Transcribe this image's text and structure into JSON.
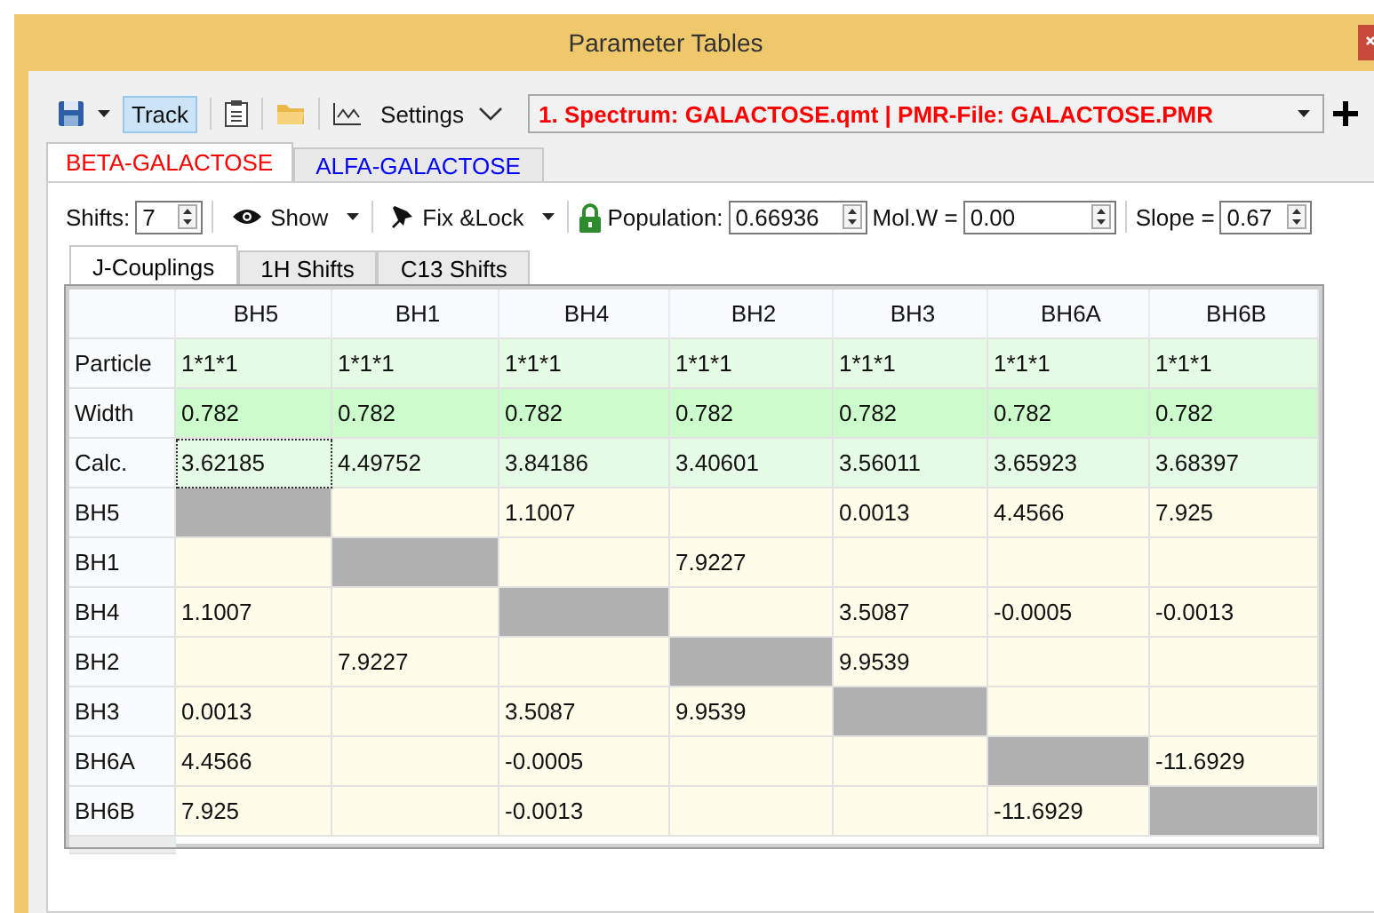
{
  "window": {
    "title": "Parameter Tables"
  },
  "toolbar": {
    "track": {
      "label": "Track",
      "on": true
    },
    "settings": {
      "label": "Settings"
    },
    "file_select": {
      "value": "1.  Spectrum: GALACTOSE.qmt | PMR-File: GALACTOSE.PMR"
    }
  },
  "tabs": [
    {
      "label": "BETA-GALACTOSE",
      "selected": true,
      "color": "#ff0000"
    },
    {
      "label": "ALFA-GALACTOSE",
      "selected": false,
      "color": "#0000ff"
    }
  ],
  "params": {
    "shifts_label": "Shifts:",
    "shifts": "7",
    "show": "Show",
    "fix_lock": "Fix &Lock",
    "population_label": "Population:",
    "population": "0.66936",
    "molw_label": "Mol.W =",
    "molw": "0.00",
    "slope_label": "Slope =",
    "slope": "0.67"
  },
  "subtabs": [
    {
      "label": "J-Couplings",
      "selected": true
    },
    {
      "label": "1H Shifts",
      "selected": false
    },
    {
      "label": "C13 Shifts",
      "selected": false
    }
  ],
  "table": {
    "columns": [
      "BH5",
      "BH1",
      "BH4",
      "BH2",
      "BH3",
      "BH6A",
      "BH6B"
    ],
    "rows": [
      {
        "header": "Particle",
        "kind": "particle",
        "cells": [
          {
            "text": "1*1*1"
          },
          {
            "text": "1*1*1"
          },
          {
            "text": "1*1*1"
          },
          {
            "text": "1*1*1"
          },
          {
            "text": "1*1*1"
          },
          {
            "text": "1*1*1"
          },
          {
            "text": "1*1*1"
          }
        ]
      },
      {
        "header": "Width",
        "kind": "width",
        "cells": [
          {
            "text": "0.782"
          },
          {
            "text": "0.782"
          },
          {
            "text": "0.782"
          },
          {
            "text": "0.782"
          },
          {
            "text": "0.782"
          },
          {
            "text": "0.782"
          },
          {
            "text": "0.782"
          }
        ]
      },
      {
        "header": "Calc.",
        "kind": "calc",
        "cells": [
          {
            "text": "3.62185",
            "focused": true
          },
          {
            "text": "4.49752",
            "focused": false
          },
          {
            "text": "3.84186",
            "focused": false
          },
          {
            "text": "3.40601",
            "focused": false
          },
          {
            "text": "3.56011",
            "focused": false
          },
          {
            "text": "3.65923",
            "focused": false
          },
          {
            "text": "3.68397",
            "focused": false
          }
        ]
      },
      {
        "header": "BH5",
        "kind": "coupling",
        "cells": [
          {
            "kind": "diagonal"
          },
          {
            "kind": "empty"
          },
          {
            "text": "1.1007"
          },
          {
            "kind": "empty"
          },
          {
            "text": "0.0013"
          },
          {
            "text": "4.4566"
          },
          {
            "text": "7.925"
          }
        ]
      },
      {
        "header": "BH1",
        "kind": "coupling",
        "cells": [
          {
            "kind": "empty"
          },
          {
            "kind": "diagonal"
          },
          {
            "kind": "empty"
          },
          {
            "text": "7.9227"
          },
          {
            "kind": "empty"
          },
          {
            "kind": "empty"
          },
          {
            "kind": "empty"
          }
        ]
      },
      {
        "header": "BH4",
        "kind": "coupling",
        "cells": [
          {
            "text": "1.1007"
          },
          {
            "kind": "empty"
          },
          {
            "kind": "diagonal"
          },
          {
            "kind": "empty"
          },
          {
            "text": "3.5087"
          },
          {
            "text": "-0.0005"
          },
          {
            "text": "-0.0013"
          }
        ]
      },
      {
        "header": "BH2",
        "kind": "coupling",
        "cells": [
          {
            "kind": "empty"
          },
          {
            "text": "7.9227"
          },
          {
            "kind": "empty"
          },
          {
            "kind": "diagonal"
          },
          {
            "text": "9.9539"
          },
          {
            "kind": "empty"
          },
          {
            "kind": "empty"
          }
        ]
      },
      {
        "header": "BH3",
        "kind": "coupling",
        "cells": [
          {
            "text": "0.0013"
          },
          {
            "kind": "empty"
          },
          {
            "text": "3.5087"
          },
          {
            "text": "9.9539"
          },
          {
            "kind": "diagonal"
          },
          {
            "kind": "empty"
          },
          {
            "kind": "empty"
          }
        ]
      },
      {
        "header": "BH6A",
        "kind": "coupling",
        "cells": [
          {
            "text": "4.4566"
          },
          {
            "kind": "empty"
          },
          {
            "text": "-0.0005"
          },
          {
            "kind": "empty"
          },
          {
            "kind": "empty"
          },
          {
            "kind": "diagonal"
          },
          {
            "text": "-11.6929"
          }
        ]
      },
      {
        "header": "BH6B",
        "kind": "coupling",
        "cells": [
          {
            "text": "7.925"
          },
          {
            "kind": "empty"
          },
          {
            "text": "-0.0013"
          },
          {
            "kind": "empty"
          },
          {
            "kind": "empty"
          },
          {
            "text": "-11.6929"
          },
          {
            "kind": "diagonal"
          }
        ]
      }
    ]
  }
}
